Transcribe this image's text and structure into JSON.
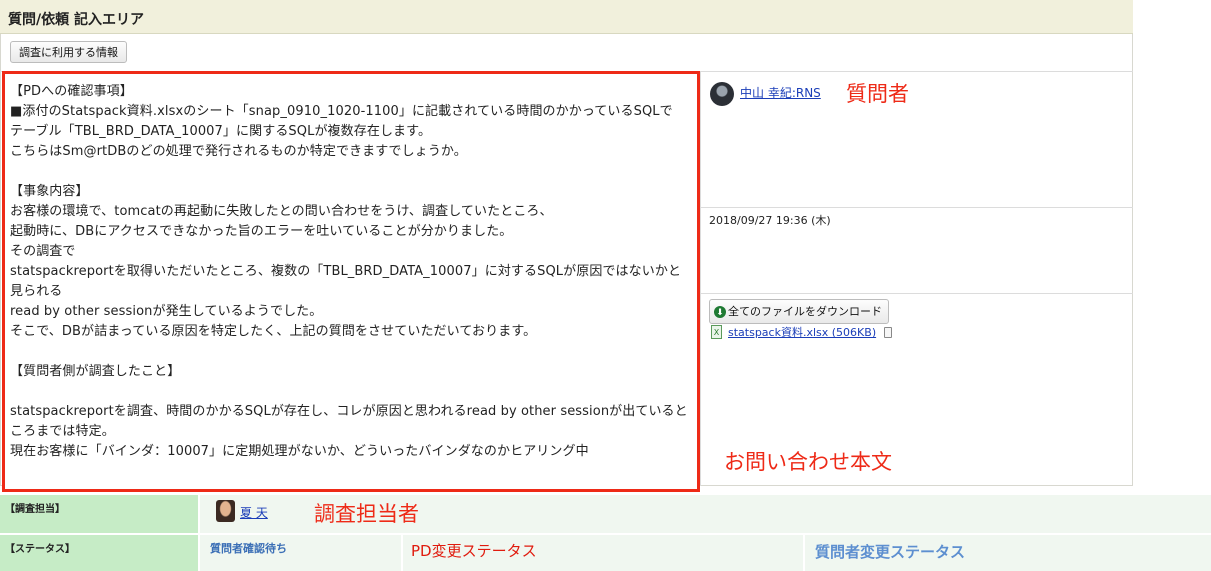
{
  "header": {
    "title": "質問/依頼 記入エリア"
  },
  "toolbar": {
    "info_button": "調査に利用する情報"
  },
  "inquiry": {
    "body": "【PDへの確認事項】\n■添付のStatspack資料.xlsxのシート「snap_0910_1020-1100」に記載されている時間のかかっているSQLで\nテーブル「TBL_BRD_DATA_10007」に関するSQLが複数存在します。\nこちらはSm@rtDBのどの処理で発行されるものか特定できますでしょうか。\n\n【事象内容】\nお客様の環境で、tomcatの再起動に失敗したとの問い合わせをうけ、調査していたところ、\n起動時に、DBにアクセスできなかった旨のエラーを吐いていることが分かりました。\nその調査で\nstatspackreportを取得いただいたところ、複数の「TBL_BRD_DATA_10007」に対するSQLが原因ではないかと見られる\nread by other sessionが発生しているようでした。\nそこで、DBが詰まっている原因を特定したく、上記の質問をさせていただいております。\n\n【質問者側が調査したこと】\n\nstatspackreportを調査、時間のかかるSQLが存在し、コレが原因と思われるread by other sessionが出ているところまでは特定。\n現在お客様に「バインダ：10007」に定期処理がないか、どういったバインダなのかヒアリング中"
  },
  "asker": {
    "name": "中山 幸紀:RNS",
    "avatar_icon": "user-avatar"
  },
  "posted_at": "2018/09/27 19:36 (木)",
  "attachments": {
    "download_all_label": "全てのファイルをダウンロード",
    "files": [
      {
        "name": "statspack資料.xlsx (506KB)",
        "icon": "excel-file-icon"
      }
    ]
  },
  "annotations": {
    "asker": "質問者",
    "body": "お問い合わせ本文",
    "assignee": "調査担当者",
    "pd_status": "PD変更ステータス",
    "asker_status": "質問者変更ステータス"
  },
  "assignment": {
    "label": "【調査担当】",
    "assignee": "夏 天"
  },
  "status": {
    "label": "【ステータス】",
    "value": "質問者確認待ち"
  },
  "colors": {
    "annotation_red": "#ee2a17",
    "header_bg": "#f1f0dc",
    "label_green": "#c6ecc6",
    "link_blue": "#1a3db8"
  }
}
